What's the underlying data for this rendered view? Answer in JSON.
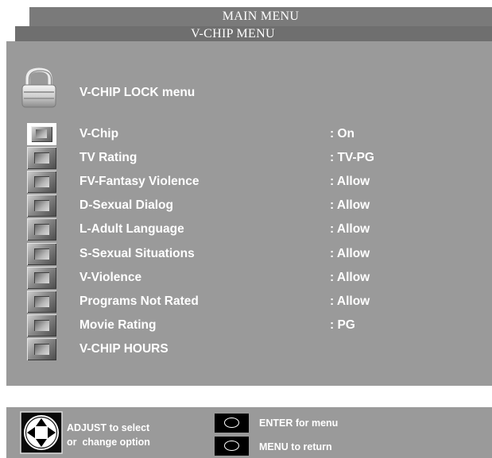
{
  "header": {
    "main_menu_title": "MAIN MENU",
    "vchip_menu_title": "V-CHIP MENU"
  },
  "lock_menu": {
    "title": "V-CHIP LOCK menu",
    "icon": "padlock-icon"
  },
  "menu_items": [
    {
      "label": "V-Chip",
      "value": ": On",
      "selected": true
    },
    {
      "label": "TV Rating",
      "value": ": TV-PG",
      "selected": false
    },
    {
      "label": "FV-Fantasy Violence",
      "value": ": Allow",
      "selected": false
    },
    {
      "label": "D-Sexual Dialog",
      "value": ": Allow",
      "selected": false
    },
    {
      "label": "L-Adult Language",
      "value": ": Allow",
      "selected": false
    },
    {
      "label": "S-Sexual Situations",
      "value": ": Allow",
      "selected": false
    },
    {
      "label": "V-Violence",
      "value": ": Allow",
      "selected": false
    },
    {
      "label": "Programs Not Rated",
      "value": ": Allow",
      "selected": false
    },
    {
      "label": "Movie Rating",
      "value": ": PG",
      "selected": false
    },
    {
      "label": "V-CHIP HOURS",
      "value": "",
      "selected": false
    }
  ],
  "footer": {
    "adjust_line1": "ADJUST to select",
    "adjust_line2": "or  change option",
    "enter_text": "ENTER for menu",
    "menu_text": "MENU to return"
  },
  "colors": {
    "panel": "#9a9a9a",
    "tab_main": "#7a7a7a",
    "tab_vchip": "#6f6f6f",
    "text": "#ffffff",
    "button": "#000000"
  }
}
